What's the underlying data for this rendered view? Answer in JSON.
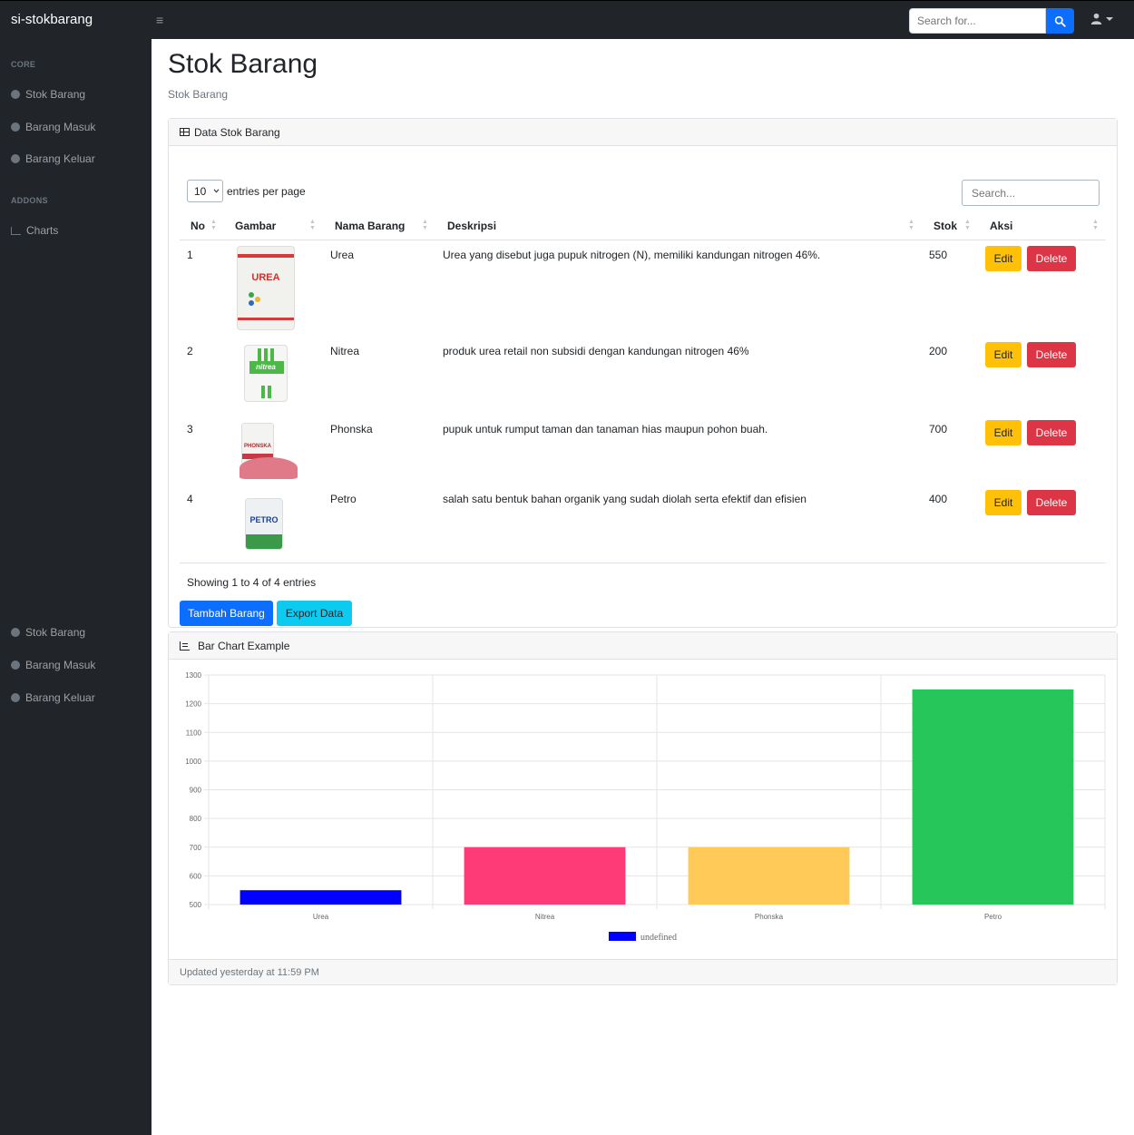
{
  "app": {
    "brand": "si-stokbarang"
  },
  "topbar": {
    "search_placeholder": "Search for..."
  },
  "sidebar": {
    "heading_core": "CORE",
    "heading_addons": "ADDONS",
    "items": [
      {
        "label": "Stok Barang"
      },
      {
        "label": "Barang Masuk"
      },
      {
        "label": "Barang Keluar"
      }
    ],
    "charts_label": "Charts",
    "footer_items": [
      {
        "label": "Stok Barang"
      },
      {
        "label": "Barang Masuk"
      },
      {
        "label": "Barang Keluar"
      }
    ]
  },
  "page": {
    "title": "Stok Barang",
    "breadcrumb": "Stok Barang"
  },
  "table_card": {
    "header": "Data Stok Barang",
    "per_page_value": "10",
    "per_page_label": "entries per page",
    "search_placeholder": "Search...",
    "columns": [
      "No",
      "Gambar",
      "Nama Barang",
      "Deskripsi",
      "Stok",
      "Aksi"
    ],
    "rows": [
      {
        "no": "1",
        "image": "urea-bag-image",
        "name": "Urea",
        "desc": "Urea yang disebut juga pupuk nitrogen (N), memiliki kandungan nitrogen 46%.",
        "stok": "550"
      },
      {
        "no": "2",
        "image": "nitrea-bag-image",
        "name": "Nitrea",
        "desc": "produk urea retail non subsidi dengan kandungan nitrogen 46%",
        "stok": "200"
      },
      {
        "no": "3",
        "image": "phonska-bag-image",
        "name": "Phonska",
        "desc": "pupuk untuk rumput taman dan tanaman hias maupun pohon buah.",
        "stok": "700"
      },
      {
        "no": "4",
        "image": "petro-bag-image",
        "name": "Petro",
        "desc": "salah satu bentuk bahan organik yang sudah diolah serta efektif dan efisien",
        "stok": "400"
      }
    ],
    "edit_label": "Edit",
    "delete_label": "Delete",
    "info": "Showing 1 to 4 of 4 entries",
    "add_label": "Tambah Barang",
    "export_label": "Export Data",
    "image_texts": {
      "urea": "UREA",
      "nitrea": "nitrea",
      "phonska": "PHONSKA",
      "petro": "PETRO"
    }
  },
  "chart_card": {
    "header": "Bar Chart Example",
    "footer": "Updated yesterday at 11:59 PM"
  },
  "chart_data": {
    "type": "bar",
    "categories": [
      "Urea",
      "Nitrea",
      "Phonska",
      "Petro"
    ],
    "values": [
      550,
      700,
      700,
      1250
    ],
    "colors": [
      "#0000ff",
      "#ff3b77",
      "#ffca57",
      "#27c65a"
    ],
    "ylim": [
      500,
      1300
    ],
    "yticks": [
      "500",
      "600",
      "700",
      "800",
      "900",
      "1000",
      "1100",
      "1200",
      "1300"
    ],
    "legend": "undefined",
    "legend_color": "#0000ff",
    "grid": true
  }
}
